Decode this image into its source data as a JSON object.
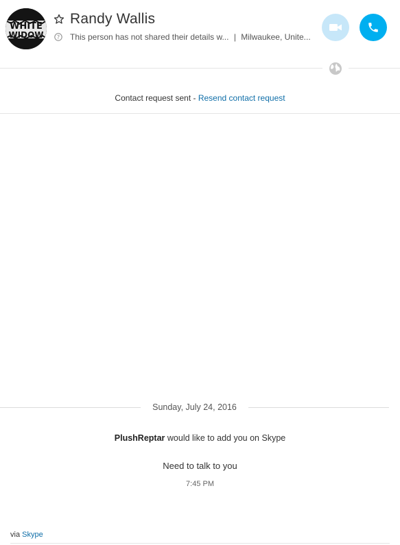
{
  "header": {
    "contact_name": "Randy Wallis",
    "status_text": "This person has not shared their details w...",
    "separator": "|",
    "location": "Milwaukee, Unite...",
    "avatar_text_top": "WHITE",
    "avatar_text_bottom": "WIDOW",
    "icons": {
      "favorite": "star-outline-icon",
      "info": "question-circle-icon",
      "video": "video-camera-icon",
      "audio": "phone-icon",
      "globe": "globe-icon"
    },
    "colors": {
      "video_button": "#c7e7f9",
      "audio_button": "#00aff0"
    }
  },
  "contact_request": {
    "text": "Contact request sent -",
    "link": "Resend contact request"
  },
  "conversation": {
    "date_separator": "Sunday, July 24, 2016",
    "request": {
      "sender": "PlushReptar",
      "text": "would like to add you on Skype"
    },
    "message": "Need to talk to you",
    "time": "7:45 PM"
  },
  "footer": {
    "via_label": "via",
    "via_link": "Skype"
  },
  "accent_color": "#0f6ea8"
}
